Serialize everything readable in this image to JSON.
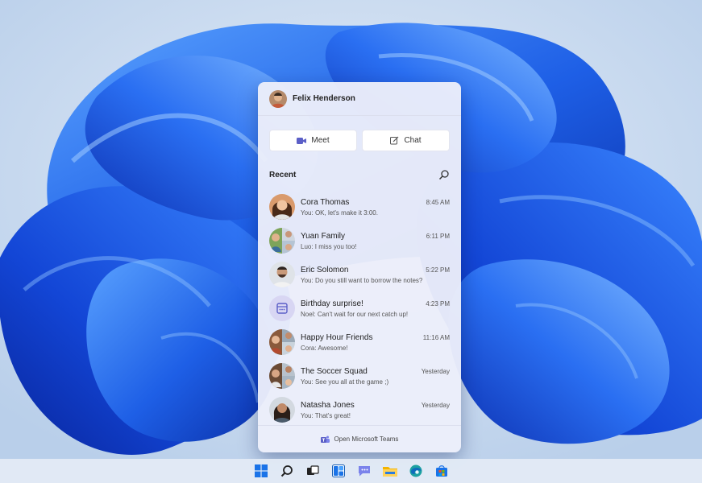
{
  "user": {
    "name": "Felix Henderson"
  },
  "actions": {
    "meet_label": "Meet",
    "chat_label": "Chat"
  },
  "recent": {
    "label": "Recent"
  },
  "chats": [
    {
      "name": "Cora Thomas",
      "preview": "You: OK, let's make it 3:00.",
      "time": "8:45 AM"
    },
    {
      "name": "Yuan Family",
      "preview": "Luo: I miss you too!",
      "time": "6:11 PM"
    },
    {
      "name": "Eric Solomon",
      "preview": "You: Do you still want to borrow the notes?",
      "time": "5:22 PM"
    },
    {
      "name": "Birthday surprise!",
      "preview": "Noel: Can't wait for our next catch up!",
      "time": "4:23 PM"
    },
    {
      "name": "Happy Hour Friends",
      "preview": "Cora: Awesome!",
      "time": "11:16 AM"
    },
    {
      "name": "The Soccer Squad",
      "preview": "You: See you all at the game ;)",
      "time": "Yesterday"
    },
    {
      "name": "Natasha Jones",
      "preview": "You: That's great!",
      "time": "Yesterday"
    }
  ],
  "footer": {
    "open_teams_label": "Open Microsoft Teams"
  },
  "taskbar": {
    "icons": [
      "windows-start-icon",
      "search-icon",
      "task-view-icon",
      "widgets-icon",
      "teams-chat-icon",
      "file-explorer-icon",
      "edge-browser-icon",
      "microsoft-store-icon"
    ]
  },
  "colors": {
    "accent": "#5b5fc7",
    "wallpaper_blue": "#1f63e6"
  }
}
